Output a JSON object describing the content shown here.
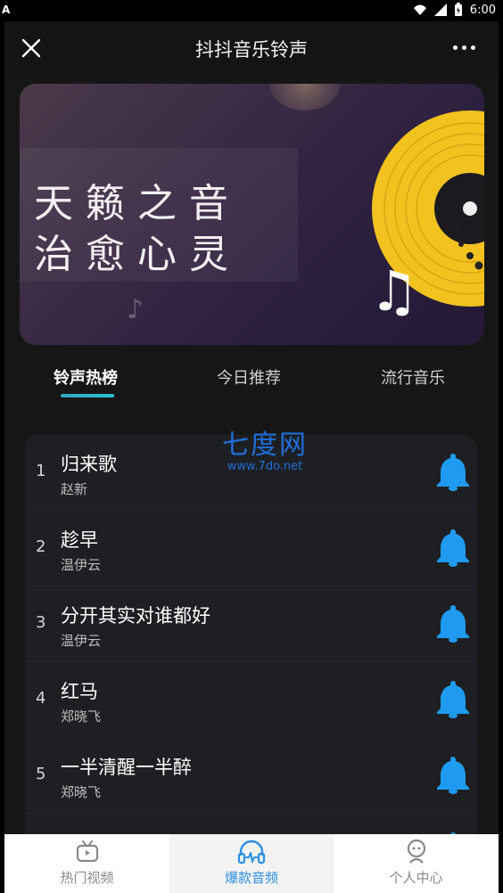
{
  "status_bar": {
    "left_icon": "A",
    "time": "6:00"
  },
  "app_bar": {
    "title": "抖抖音乐铃声"
  },
  "banner": {
    "line1": "天籁之音",
    "line2": "治愈心灵"
  },
  "tabs": [
    {
      "label": "铃声热榜",
      "active": true
    },
    {
      "label": "今日推荐",
      "active": false
    },
    {
      "label": "流行音乐",
      "active": false
    }
  ],
  "watermark": {
    "name": "七度网",
    "url": "www.7do.net"
  },
  "songs": [
    {
      "rank": "1",
      "title": "归来歌",
      "artist": "赵新"
    },
    {
      "rank": "2",
      "title": "趁早",
      "artist": "温伊云"
    },
    {
      "rank": "3",
      "title": "分开其实对谁都好",
      "artist": "温伊云"
    },
    {
      "rank": "4",
      "title": "红马",
      "artist": "郑晓飞"
    },
    {
      "rank": "5",
      "title": "一半清醒一半醉",
      "artist": "郑晓飞"
    }
  ],
  "bottom_nav": [
    {
      "label": "热门视频",
      "icon": "tv-icon",
      "active": false
    },
    {
      "label": "爆款音频",
      "icon": "headphones-icon",
      "active": true
    },
    {
      "label": "个人中心",
      "icon": "person-icon",
      "active": false
    }
  ],
  "colors": {
    "accent": "#2a8fe2",
    "bell": "#1e9bf0",
    "record": "#f2c21f"
  }
}
